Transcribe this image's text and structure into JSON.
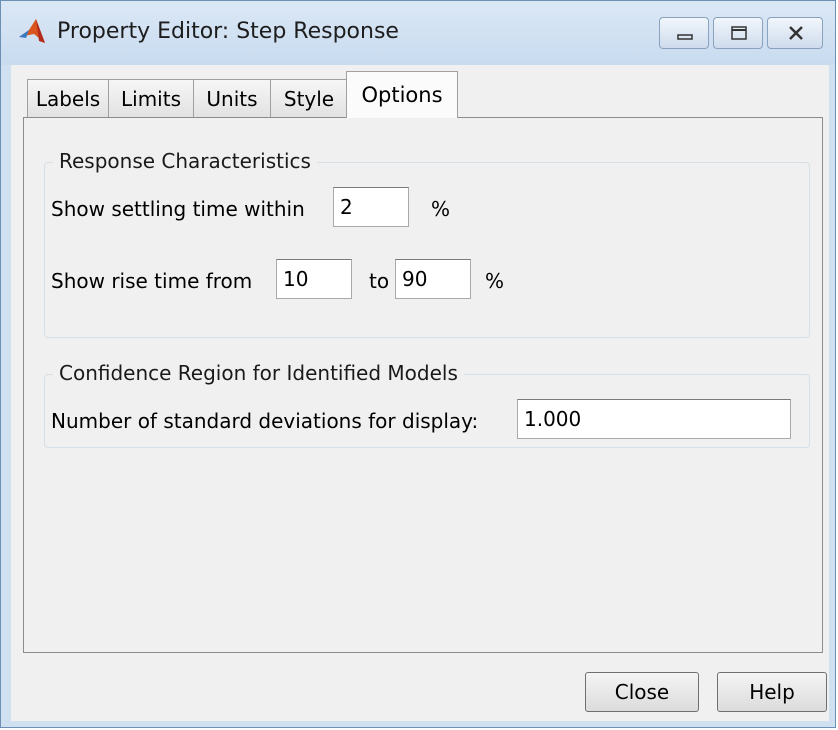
{
  "window": {
    "title": "Property Editor: Step Response",
    "icon": "matlab-logo-icon"
  },
  "titlebar_buttons": {
    "minimize_icon": "minimize-icon",
    "maximize_icon": "maximize-icon",
    "close_icon": "close-icon"
  },
  "tabs": [
    {
      "label": "Labels",
      "active": false
    },
    {
      "label": "Limits",
      "active": false
    },
    {
      "label": "Units",
      "active": false
    },
    {
      "label": "Style",
      "active": false
    },
    {
      "label": "Options",
      "active": true
    }
  ],
  "response_characteristics": {
    "title": "Response Characteristics",
    "settling_label": "Show settling time within",
    "settling_value": "2",
    "settling_unit": "%",
    "rise_label": "Show rise time from",
    "rise_from_value": "10",
    "rise_to_label": "to",
    "rise_to_value": "90",
    "rise_unit": "%"
  },
  "confidence_region": {
    "title": "Confidence Region for Identified Models",
    "std_label": "Number of standard deviations for display:",
    "std_value": "1.000"
  },
  "buttons": {
    "close": "Close",
    "help": "Help"
  },
  "colors": {
    "titlebar": "#cfe0f1",
    "panel": "#f0f0f0",
    "matlab_orange": "#d9541e",
    "matlab_red": "#b52b1b"
  }
}
